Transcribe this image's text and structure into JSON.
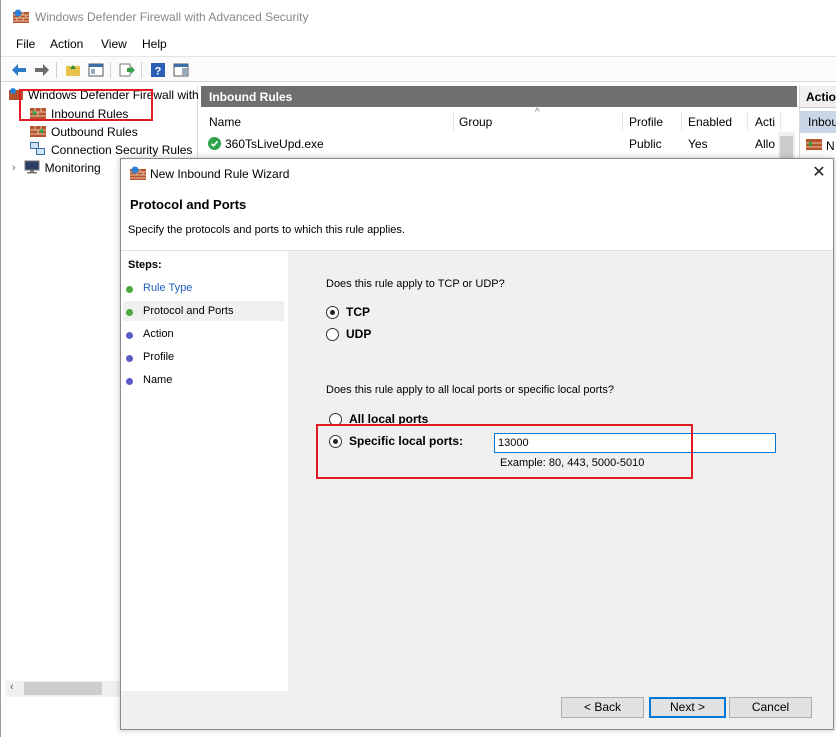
{
  "window": {
    "title": "Windows Defender Firewall with Advanced Security"
  },
  "menu": {
    "file": "File",
    "action": "Action",
    "view": "View",
    "help": "Help"
  },
  "tree": {
    "root": "Windows Defender Firewall with",
    "items": [
      {
        "label": "Inbound Rules"
      },
      {
        "label": "Outbound Rules"
      },
      {
        "label": "Connection Security Rules"
      },
      {
        "label": "Monitoring"
      }
    ]
  },
  "rules_pane": {
    "header": "Inbound Rules",
    "columns": [
      "Name",
      "Group",
      "Profile",
      "Enabled",
      "Acti"
    ],
    "rows": [
      {
        "name": "360TsLiveUpd.exe",
        "group": "",
        "profile": "Public",
        "enabled": "Yes",
        "action": "Allo"
      }
    ]
  },
  "actions_pane": {
    "header": "Actio",
    "sub": "Inbou",
    "item": "N"
  },
  "dialog": {
    "title": "New Inbound Rule Wizard",
    "heading": "Protocol and Ports",
    "subheading": "Specify the protocols and ports to which this rule applies.",
    "steps_title": "Steps:",
    "steps": [
      {
        "label": "Rule Type",
        "state": "done",
        "color": "#4aa83c"
      },
      {
        "label": "Protocol and Ports",
        "state": "current",
        "color": "#4aa83c"
      },
      {
        "label": "Action",
        "state": "pending",
        "color": "#5b5bc8"
      },
      {
        "label": "Profile",
        "state": "pending",
        "color": "#5b5bc8"
      },
      {
        "label": "Name",
        "state": "pending",
        "color": "#5b5bc8"
      }
    ],
    "protocol_question": "Does this rule apply to TCP or UDP?",
    "protocol_options": [
      {
        "label": "TCP",
        "selected": true
      },
      {
        "label": "UDP",
        "selected": false
      }
    ],
    "ports_question": "Does this rule apply to all local ports or specific local ports?",
    "port_options": [
      {
        "label": "All local ports",
        "selected": false
      },
      {
        "label": "Specific local ports:",
        "selected": true
      }
    ],
    "port_value": "13000",
    "port_example": "Example: 80, 443, 5000-5010",
    "buttons": {
      "back": "< Back",
      "next": "Next >",
      "cancel": "Cancel"
    }
  },
  "colors": {
    "annotation_red": "#e01b24",
    "pane_header": "#6f6f6f",
    "accent_blue": "#0078d7"
  }
}
